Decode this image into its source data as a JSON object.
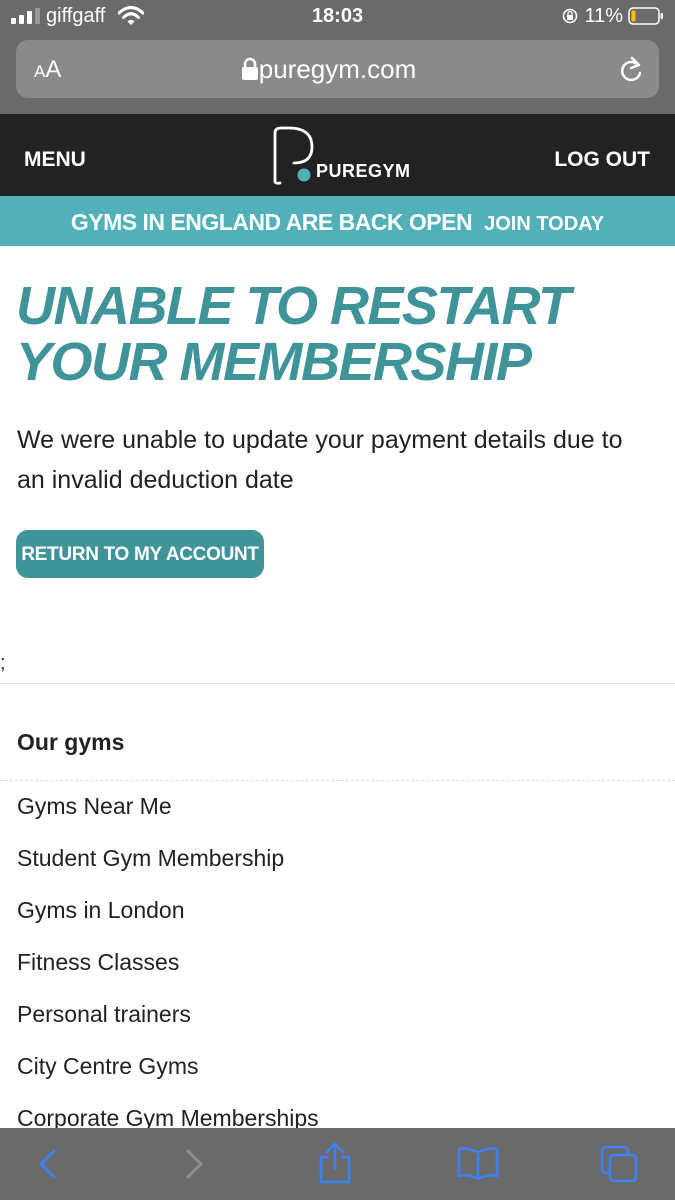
{
  "status_bar": {
    "carrier": "giffgaff",
    "time": "18:03",
    "battery": "11%"
  },
  "browser": {
    "text_size_label": "A",
    "text_size_label_big": "A",
    "url": "puregym.com"
  },
  "header": {
    "menu_label": "MENU",
    "logo_text": "PUREGYM",
    "logout_label": "LOG OUT"
  },
  "banner": {
    "message": "GYMS IN ENGLAND ARE BACK OPEN",
    "cta": "JOIN TODAY"
  },
  "main": {
    "title": "UNABLE TO RESTART YOUR MEMBERSHIP",
    "message": "We were unable to update your payment details due to an invalid deduction date",
    "button_label": "RETURN TO MY ACCOUNT",
    "stray_text": ";"
  },
  "footer": {
    "heading": "Our gyms",
    "links": [
      "Gyms Near Me",
      "Student Gym Membership",
      "Gyms in London",
      "Fitness Classes",
      "Personal trainers",
      "City Centre Gyms",
      "Corporate Gym Memberships"
    ]
  },
  "colors": {
    "brand_teal": "#3f949a",
    "banner_teal": "#52b0b8",
    "header_dark": "#222222",
    "ios_blue": "#3a82f7"
  },
  "icons": [
    "signal-icon",
    "wifi-icon",
    "rotation-lock-icon",
    "battery-icon",
    "padlock-icon",
    "reload-icon",
    "back-icon",
    "forward-icon",
    "share-icon",
    "bookmarks-icon",
    "tabs-icon"
  ]
}
